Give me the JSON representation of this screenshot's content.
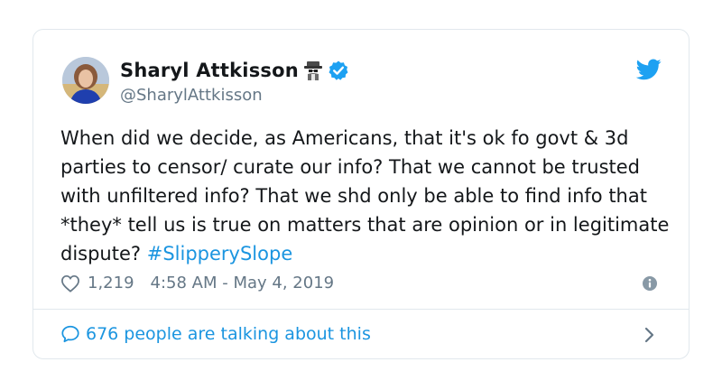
{
  "author": {
    "name": "Sharyl Attkisson",
    "handle": "@SharylAttkisson",
    "emoji_icon": "detective-emoji",
    "verified_icon": "verified-badge-icon"
  },
  "tweet": {
    "text": "When did we decide, as Americans, that it's ok fo govt & 3d parties to censor/ curate our info? That we cannot be trusted with unfiltered info? That we shd only be able to find info that *they* tell us is true on matters that are opinion or in legitimate dispute? ",
    "hashtag": "#SlipperySlope"
  },
  "meta": {
    "likes": "1,219",
    "timestamp": "4:58 AM - May 4, 2019"
  },
  "footer": {
    "talking": "676 people are talking about this"
  },
  "colors": {
    "accent": "#1b95e0",
    "muted": "#657786",
    "border": "#e1e8ed"
  }
}
